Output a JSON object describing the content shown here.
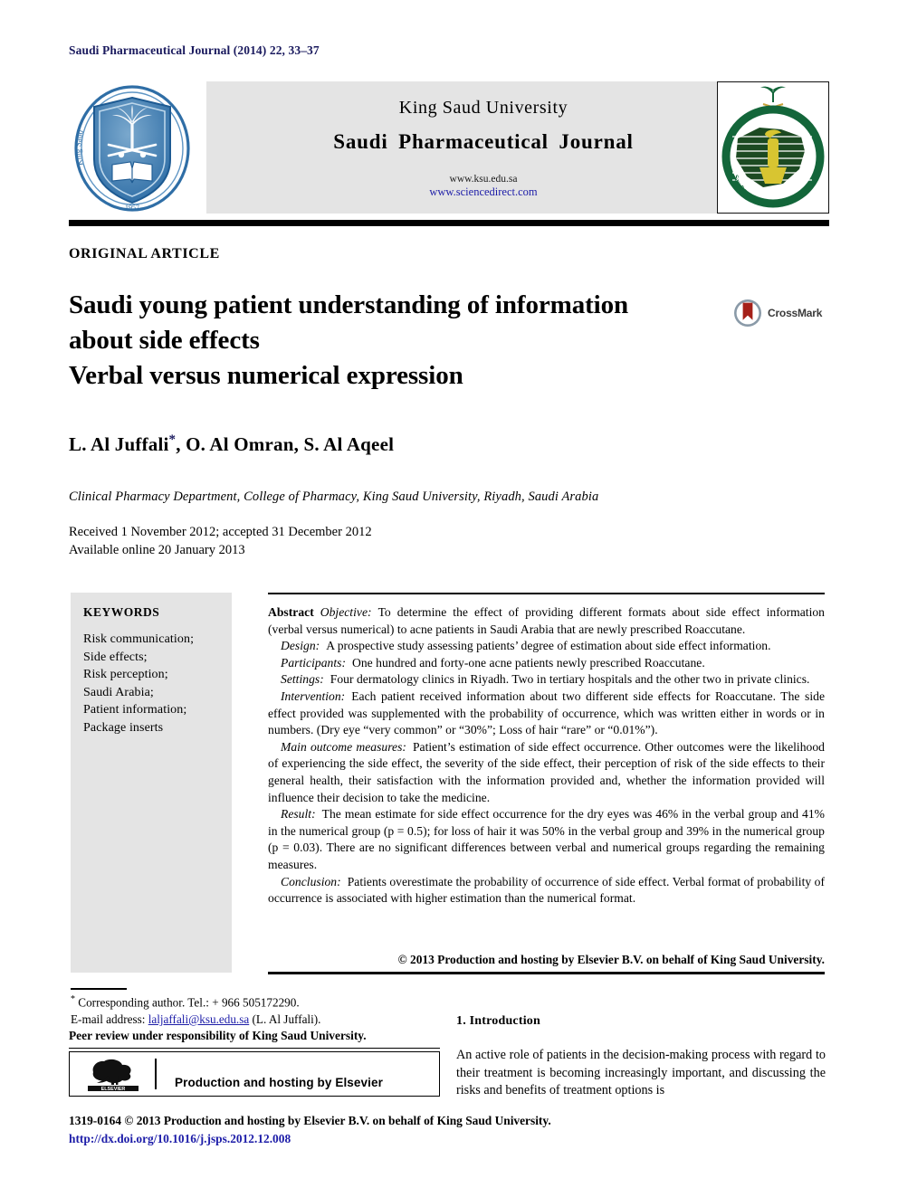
{
  "running_head": "Saudi Pharmaceutical Journal (2014) 22, 33–37",
  "header": {
    "university": "King Saud University",
    "journal": "Saudi Pharmaceutical Journal",
    "url_primary": "www.ksu.edu.sa",
    "url_secondary": "www.sciencedirect.com",
    "left_logo_name": "king-saud-university-seal",
    "left_logo_text_en": "King Saud University",
    "left_logo_year": "1957",
    "right_logo_name": "saudi-pharmaceutical-society-emblem",
    "right_logo_text_en": "Saudi Pharmaceutical Society"
  },
  "article": {
    "type": "ORIGINAL ARTICLE",
    "title_line1": "Saudi young patient understanding of information",
    "title_line2": "about side effects",
    "title_line3": "Verbal versus numerical expression",
    "crossmark_label": "CrossMark",
    "authors": "L. Al Juffali",
    "author_star": "*",
    "authors_rest": ", O. Al Omran, S. Al Aqeel",
    "affiliation": "Clinical Pharmacy Department, College of Pharmacy, King Saud University, Riyadh, Saudi Arabia",
    "received": "Received 1 November 2012; accepted 31 December 2012",
    "available": "Available online 20 January 2013"
  },
  "keywords": {
    "heading": "KEYWORDS",
    "items": [
      "Risk communication;",
      "Side effects;",
      "Risk perception;",
      "Saudi Arabia;",
      "Patient information;",
      "Package inserts"
    ]
  },
  "abstract": {
    "label": "Abstract",
    "sections": [
      {
        "label": "Objective:",
        "text": "To determine the effect of providing different formats about side effect information (verbal versus numerical) to acne patients in Saudi Arabia that are newly prescribed Roaccutane."
      },
      {
        "label": "Design:",
        "text": "A prospective study assessing patients’ degree of estimation about side effect information."
      },
      {
        "label": "Participants:",
        "text": "One hundred and forty-one acne patients newly prescribed Roaccutane."
      },
      {
        "label": "Settings:",
        "text": "Four dermatology clinics in Riyadh. Two in tertiary hospitals and the other two in private clinics."
      },
      {
        "label": "Intervention:",
        "text": "Each patient received information about two different side effects for Roaccutane. The side effect provided was supplemented with the probability of occurrence, which was written either in words or in numbers. (Dry eye “very common” or “30%”; Loss of hair “rare” or “0.01%”)."
      },
      {
        "label": "Main outcome measures:",
        "text": "Patient’s estimation of side effect occurrence. Other outcomes were the likelihood of experiencing the side effect, the severity of the side effect, their perception of risk of the side effects to their general health, their satisfaction with the information provided and, whether the information provided will influence their decision to take the medicine."
      },
      {
        "label": "Result:",
        "text": "The mean estimate for side effect occurrence for the dry eyes was 46% in the verbal group and 41% in the numerical group (p = 0.5); for loss of hair it was 50% in the verbal group and 39% in the numerical group (p = 0.03). There are no significant differences between verbal and numerical groups regarding the remaining measures."
      },
      {
        "label": "Conclusion:",
        "text": "Patients overestimate the probability of occurrence of side effect. Verbal format of probability of occurrence is associated with higher estimation than the numerical format."
      }
    ],
    "copyright": "© 2013 Production and hosting by Elsevier B.V. on behalf of King Saud University."
  },
  "footnotes": {
    "corresponding": "Corresponding author. Tel.: + 966 505172290.",
    "email_label": "E-mail address:",
    "email": "laljaffali@ksu.edu.sa",
    "email_owner": "(L. Al Juffali).",
    "peer_review": "Peer review under responsibility of King Saud University."
  },
  "elsevier_box": {
    "logo_name": "elsevier-tree-logo",
    "logo_wordmark": "ELSEVIER",
    "text": "Production and hosting by Elsevier"
  },
  "footer": {
    "issn_line": "1319-0164 © 2013 Production and hosting by Elsevier B.V. on behalf of King Saud University.",
    "doi": "http://dx.doi.org/10.1016/j.jsps.2012.12.008"
  },
  "introduction": {
    "heading": "1. Introduction",
    "paragraph": "An active role of patients in the decision-making process with regard to their treatment is becoming increasingly important, and discussing the risks and benefits of treatment options is"
  },
  "colors": {
    "running_head": "#1a1a5e",
    "link": "#1c1ca8",
    "band_gray": "#e4e4e4",
    "ksu_blue": "#2a6ca8",
    "sps_green": "#13663a",
    "crossmark_red": "#a52019"
  }
}
